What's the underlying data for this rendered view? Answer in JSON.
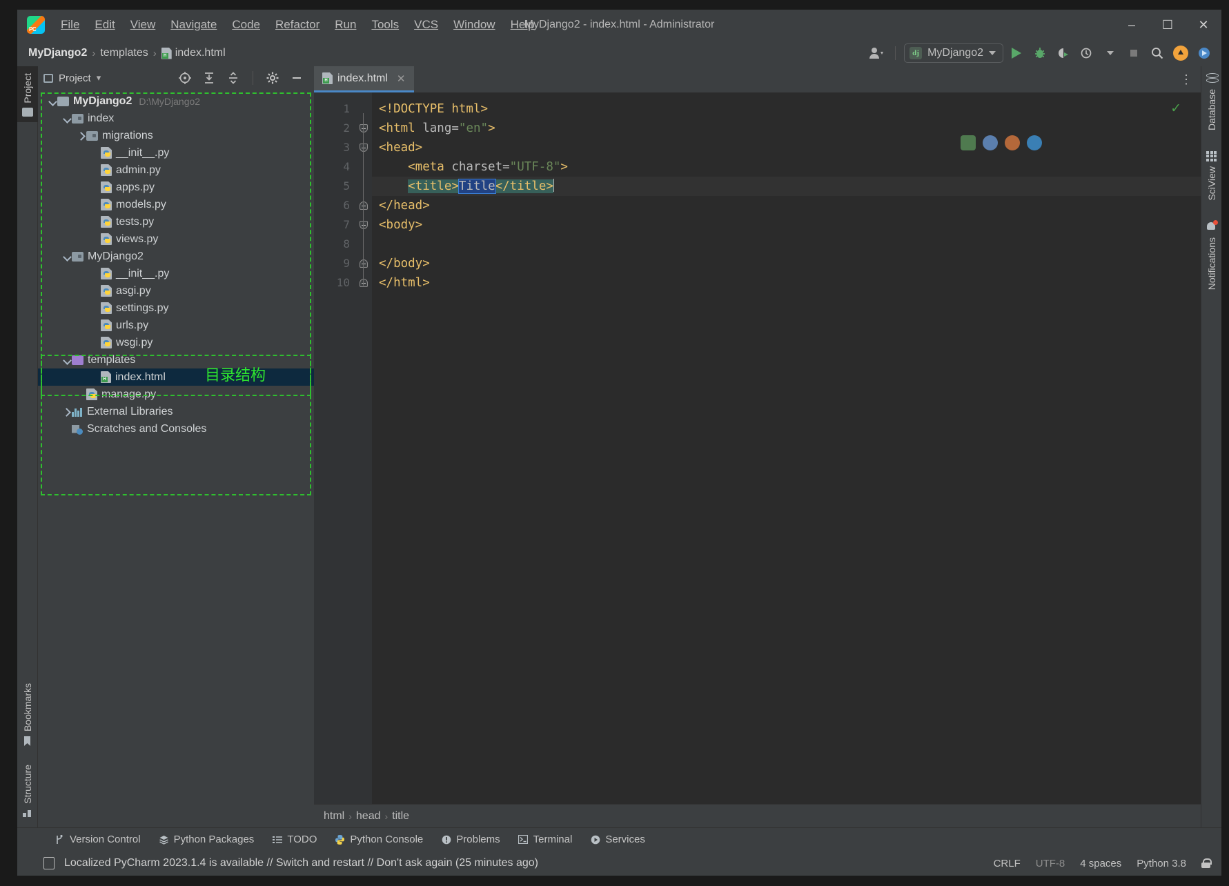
{
  "window": {
    "title": "MyDjango2 - index.html - Administrator",
    "minimize": "–",
    "maximize": "☐",
    "close": "✕"
  },
  "menu": [
    {
      "label": "File"
    },
    {
      "label": "Edit"
    },
    {
      "label": "View"
    },
    {
      "label": "Navigate"
    },
    {
      "label": "Code"
    },
    {
      "label": "Refactor"
    },
    {
      "label": "Run"
    },
    {
      "label": "Tools"
    },
    {
      "label": "VCS"
    },
    {
      "label": "Window"
    },
    {
      "label": "Help"
    }
  ],
  "navbar": {
    "breadcrumbs": [
      {
        "label": "MyDjango2",
        "icon": "none"
      },
      {
        "label": "templates",
        "icon": "none"
      },
      {
        "label": "index.html",
        "icon": "html-file-icon"
      }
    ],
    "separator": "›",
    "run_config": "MyDjango2",
    "run_config_icon": "django-icon",
    "profile_icon": "user-profile-icon",
    "buttons": [
      "run-button",
      "debug-button",
      "run-coverage-button",
      "profile-button",
      "stop-button",
      "search-button",
      "update-button",
      "plugin-button"
    ]
  },
  "left_rail": {
    "top_label": "Project",
    "bottom_labels": [
      "Bookmarks",
      "Structure"
    ]
  },
  "right_rail": {
    "labels": [
      "Database",
      "SciView",
      "Notifications"
    ]
  },
  "project_panel": {
    "title": "Project",
    "title_caret": "▾",
    "tools": [
      "locate-icon",
      "expand-all-icon",
      "collapse-all-icon",
      "settings-gear-icon",
      "hide-icon"
    ],
    "tree": [
      {
        "label": "MyDjango2",
        "path": "D:\\MyDjango2",
        "indent": 0,
        "icon": "folder-project",
        "arrow": "down",
        "bold": true
      },
      {
        "label": "index",
        "indent": 1,
        "icon": "folder-module",
        "arrow": "down"
      },
      {
        "label": "migrations",
        "indent": 2,
        "icon": "folder-module",
        "arrow": "right"
      },
      {
        "label": "__init__.py",
        "indent": 3,
        "icon": "python-file"
      },
      {
        "label": "admin.py",
        "indent": 3,
        "icon": "python-file"
      },
      {
        "label": "apps.py",
        "indent": 3,
        "icon": "python-file"
      },
      {
        "label": "models.py",
        "indent": 3,
        "icon": "python-file"
      },
      {
        "label": "tests.py",
        "indent": 3,
        "icon": "python-file"
      },
      {
        "label": "views.py",
        "indent": 3,
        "icon": "python-file"
      },
      {
        "label": "MyDjango2",
        "indent": 1,
        "icon": "folder-module",
        "arrow": "down"
      },
      {
        "label": "__init__.py",
        "indent": 3,
        "icon": "python-file"
      },
      {
        "label": "asgi.py",
        "indent": 3,
        "icon": "python-file"
      },
      {
        "label": "settings.py",
        "indent": 3,
        "icon": "python-file"
      },
      {
        "label": "urls.py",
        "indent": 3,
        "icon": "python-file"
      },
      {
        "label": "wsgi.py",
        "indent": 3,
        "icon": "python-file"
      },
      {
        "label": "templates",
        "indent": 1,
        "icon": "folder-templates",
        "arrow": "down"
      },
      {
        "label": "index.html",
        "indent": 3,
        "icon": "html-file",
        "selected": true
      },
      {
        "label": "manage.py",
        "indent": 2,
        "icon": "python-file"
      },
      {
        "label": "External Libraries",
        "indent": 1,
        "icon": "libraries",
        "arrow": "right"
      },
      {
        "label": "Scratches and Consoles",
        "indent": 1,
        "icon": "scratches"
      }
    ]
  },
  "annotation": {
    "text": "目录结构",
    "color": "#2fe62f"
  },
  "editor": {
    "tab": {
      "label": "index.html",
      "icon": "html-file-icon",
      "close": "✕"
    },
    "more_icon": "⋮",
    "inspection_ok": "✓",
    "code": [
      {
        "num": "1",
        "fold": "none",
        "parts": [
          {
            "t": "<!DOCTYPE html>",
            "c": "tg"
          }
        ]
      },
      {
        "num": "2",
        "fold": "down",
        "parts": [
          {
            "t": "<html ",
            "c": "tg"
          },
          {
            "t": "lang=",
            "c": "at"
          },
          {
            "t": "\"en\"",
            "c": "vl"
          },
          {
            "t": ">",
            "c": "tg"
          }
        ]
      },
      {
        "num": "3",
        "fold": "down",
        "parts": [
          {
            "t": "<head>",
            "c": "tg"
          }
        ]
      },
      {
        "num": "4",
        "fold": "none",
        "parts": [
          {
            "t": "    <meta ",
            "c": "tg"
          },
          {
            "t": "charset=",
            "c": "at"
          },
          {
            "t": "\"UTF-8\"",
            "c": "vl"
          },
          {
            "t": ">",
            "c": "tg"
          }
        ]
      },
      {
        "num": "5",
        "fold": "none",
        "current": true,
        "parts": [
          {
            "t": "    ",
            "c": "tg"
          },
          {
            "t": "<title>",
            "c": "tg",
            "hl": "green"
          },
          {
            "t": "Title",
            "c": "at",
            "hl": "blue"
          },
          {
            "t": "</title>",
            "c": "tg",
            "hl": "green"
          }
        ]
      },
      {
        "num": "6",
        "fold": "up",
        "parts": [
          {
            "t": "</head>",
            "c": "tg"
          }
        ]
      },
      {
        "num": "7",
        "fold": "down",
        "parts": [
          {
            "t": "<body>",
            "c": "tg"
          }
        ]
      },
      {
        "num": "8",
        "fold": "none",
        "parts": [
          {
            "t": "",
            "c": "tg"
          }
        ]
      },
      {
        "num": "9",
        "fold": "up",
        "parts": [
          {
            "t": "</body>",
            "c": "tg"
          }
        ]
      },
      {
        "num": "10",
        "fold": "up",
        "parts": [
          {
            "t": "</html>",
            "c": "tg"
          }
        ]
      }
    ],
    "breadcrumbs": [
      "html",
      "head",
      "title"
    ],
    "breadcrumb_sep": "›"
  },
  "tool_windows": [
    {
      "label": "Version Control",
      "icon": "branch-icon"
    },
    {
      "label": "Python Packages",
      "icon": "packages-icon"
    },
    {
      "label": "TODO",
      "icon": "list-icon"
    },
    {
      "label": "Python Console",
      "icon": "python-icon"
    },
    {
      "label": "Problems",
      "icon": "warning-icon"
    },
    {
      "label": "Terminal",
      "icon": "terminal-icon"
    },
    {
      "label": "Services",
      "icon": "services-icon"
    }
  ],
  "status_bar": {
    "message": "Localized PyCharm 2023.1.4 is available // Switch and restart // Don't ask again (25 minutes ago)",
    "line_ending": "CRLF",
    "encoding": "UTF-8",
    "indent": "4 spaces",
    "interpreter": "Python 3.8",
    "lock_icon": "lock-icon"
  }
}
